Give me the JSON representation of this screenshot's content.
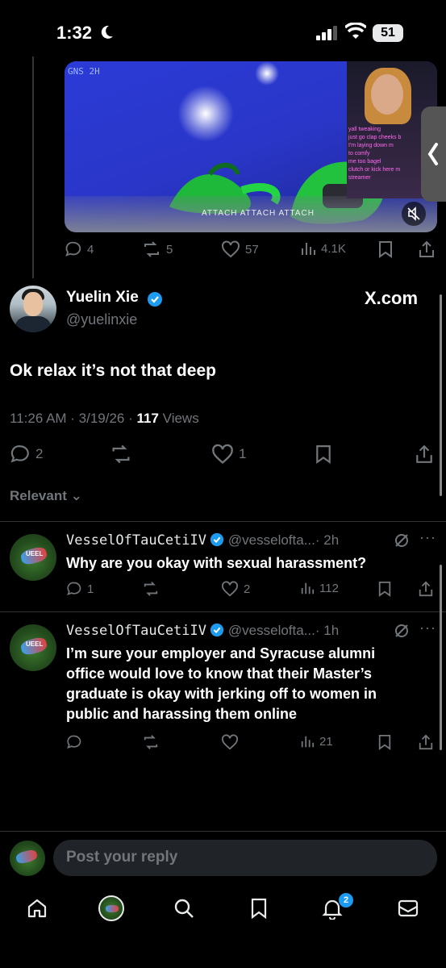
{
  "status_bar": {
    "time": "1:32",
    "battery": "51"
  },
  "media_post": {
    "hud_label": "GNS 2H",
    "chat_lines": [
      "yall tweaking",
      "just go clap cheeks b",
      "I'm laying down m",
      "to comfy",
      "me too bagel",
      "clutch or kick here m",
      "streamer"
    ],
    "attach_text": "ATTACH  ATTACH  ATTACH",
    "actions": {
      "replies": "4",
      "reposts": "5",
      "likes": "57",
      "views": "4.1K"
    }
  },
  "main_tweet": {
    "name": "Yuelin Xie",
    "handle": "@yuelinxie",
    "source_label": "X.com",
    "text": "Ok relax it’s not that deep",
    "time": "11:26 AM · 3/19/26 · ",
    "views_count": "117",
    "views_label": " Views",
    "actions": {
      "replies": "2",
      "reposts": "",
      "likes": "1"
    }
  },
  "sort_label": "Relevant",
  "replies": [
    {
      "name": "VesselOfTauCetiIV",
      "handle": "@vesselofta...",
      "age": "· 2h",
      "text": "Why are you okay with sexual harassment?",
      "actions": {
        "replies": "1",
        "reposts": "",
        "likes": "2",
        "views": "112"
      }
    },
    {
      "name": "VesselOfTauCetiIV",
      "handle": "@vesselofta...",
      "age": "· 1h",
      "text_lines": [
        "I’m sure your employer and Syracuse alumni",
        "office would love to know that their Master’s",
        "graduate is okay with jerking off to women in",
        "public and harassing them online"
      ],
      "actions": {
        "replies": "",
        "reposts": "",
        "likes": "",
        "views": "21"
      }
    }
  ],
  "avatar_tag": "UEEL",
  "composer": {
    "placeholder": "Post your reply"
  },
  "nav": {
    "notifications_badge": "2"
  },
  "colors": {
    "accent": "#1d9bf0",
    "muted": "#71767b",
    "background": "#000000"
  }
}
